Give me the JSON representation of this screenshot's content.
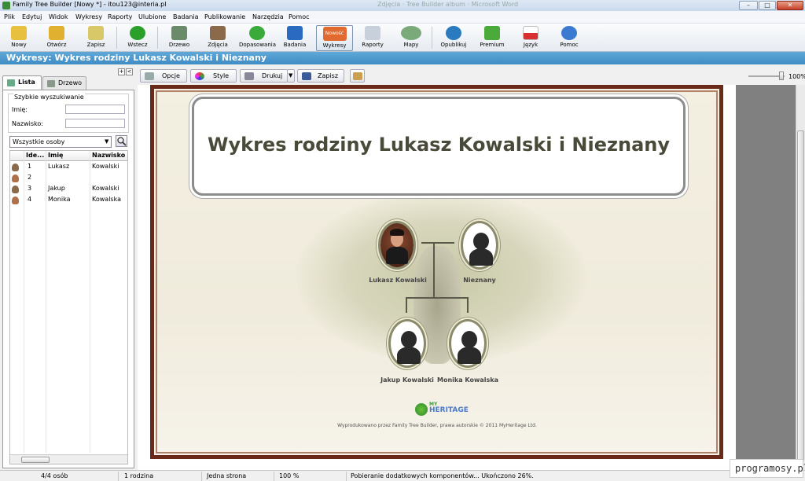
{
  "window": {
    "title": "Family Tree Builder [Nowy *] - itou123@interia.pl",
    "ghost_title": "Zdjęcia · Tree Builder album · Microsoft Word",
    "min": "–",
    "max": "□",
    "close": "✕"
  },
  "menu": [
    "Plik",
    "Edytuj",
    "Widok",
    "Wykresy",
    "Raporty",
    "Ulubione",
    "Badania",
    "Publikowanie",
    "Narzędzia",
    "Pomoc"
  ],
  "toolbar": {
    "items": [
      {
        "label": "Nowy",
        "icon": "new-file-icon",
        "color": "#e8c040"
      },
      {
        "label": "Otwórz",
        "icon": "open-folder-icon",
        "color": "#e0b030"
      },
      {
        "label": "Zapisz",
        "icon": "save-icon",
        "color": "#d8c868"
      },
      {
        "label": "Wstecz",
        "icon": "back-arrow-icon",
        "color": "#2aa02a"
      },
      {
        "label": "Drzewo",
        "icon": "tree-icon",
        "color": "#6a8a6a"
      },
      {
        "label": "Zdjęcia",
        "icon": "photos-icon",
        "color": "#8a6a4a"
      },
      {
        "label": "Dopasowania",
        "icon": "refresh-icon",
        "color": "#3aaa3a"
      },
      {
        "label": "Badania",
        "icon": "research-icon",
        "color": "#2a6ac0"
      },
      {
        "label": "Wykresy",
        "icon": "charts-icon",
        "color": "#e06a30",
        "badge": "Nowość"
      },
      {
        "label": "Raporty",
        "icon": "reports-icon",
        "color": "#c8d0dc"
      },
      {
        "label": "Mapy",
        "icon": "maps-icon",
        "color": "#7aaa7a"
      },
      {
        "label": "Opublikuj",
        "icon": "globe-icon",
        "color": "#2a7ac0"
      },
      {
        "label": "Premium",
        "icon": "premium-tree-icon",
        "color": "#4aaa3a"
      },
      {
        "label": "Język",
        "icon": "flag-icon",
        "color": "#d83030"
      },
      {
        "label": "Pomoc",
        "icon": "help-icon",
        "color": "#3a7ad0"
      }
    ]
  },
  "heading": "Wykresy: Wykres rodziny Lukasz Kowalski i Nieznany",
  "sidebar": {
    "tabs": [
      "Lista",
      "Drzewo"
    ],
    "quick_search_title": "Szybkie wyszukiwanie",
    "first_name_label": "Imię:",
    "last_name_label": "Nazwisko:",
    "first_name_value": "",
    "last_name_value": "",
    "filter": "Wszystkie osoby",
    "columns": [
      "Ide...",
      "Imię",
      "Nazwisko"
    ],
    "rows": [
      {
        "id": "1",
        "first": "Lukasz",
        "last": "Kowalski",
        "gender": "male"
      },
      {
        "id": "2",
        "first": "",
        "last": "",
        "gender": "female"
      },
      {
        "id": "3",
        "first": "Jakup",
        "last": "Kowalski",
        "gender": "male"
      },
      {
        "id": "4",
        "first": "Monika",
        "last": "Kowalska",
        "gender": "female"
      }
    ]
  },
  "chart_tools": {
    "options": "Opcje",
    "style": "Style",
    "print": "Drukuj",
    "save": "Zapisz",
    "zoom": "100%"
  },
  "chart": {
    "title": "Wykres rodziny Lukasz Kowalski i Nieznany",
    "people": {
      "father": "Lukasz Kowalski",
      "mother": "Nieznany",
      "child1": "Jakup Kowalski",
      "child2": "Monika Kowalska"
    },
    "logo_my": "MY",
    "logo_text": "HERITAGE",
    "footer": "Wyprodukowano przez Family Tree Builder, prawa autorskie © 2011 MyHeritage Ltd."
  },
  "status": {
    "persons": "4/4 osób",
    "families": "1 rodzina",
    "pages": "Jedna strona",
    "zoom": "100 %",
    "message": "Pobieranie dodatkowych komponentów... Ukończono 26%."
  },
  "watermark": "programosy.pl"
}
